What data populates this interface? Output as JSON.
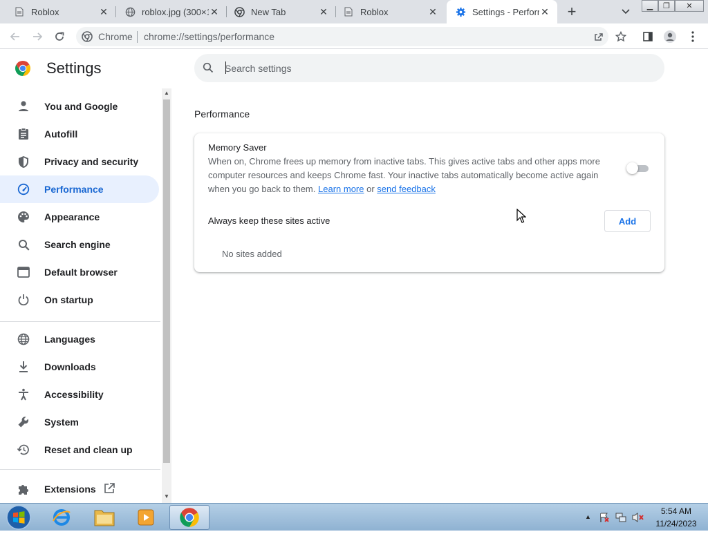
{
  "tabs": [
    {
      "title": "Roblox",
      "icon": "page-icon"
    },
    {
      "title": "roblox.jpg (300×1",
      "icon": "globe-icon"
    },
    {
      "title": "New Tab",
      "icon": "chrome-icon"
    },
    {
      "title": "Roblox",
      "icon": "page-icon"
    },
    {
      "title": "Settings - Perform",
      "icon": "gear-icon"
    }
  ],
  "omnibox": {
    "site_label": "Chrome",
    "url": "chrome://settings/performance"
  },
  "settings": {
    "title": "Settings",
    "search_placeholder": "Search settings",
    "nav_items": [
      {
        "label": "You and Google",
        "icon": "person-icon"
      },
      {
        "label": "Autofill",
        "icon": "clipboard-icon"
      },
      {
        "label": "Privacy and security",
        "icon": "shield-icon"
      },
      {
        "label": "Performance",
        "icon": "speedometer-icon",
        "active": true
      },
      {
        "label": "Appearance",
        "icon": "palette-icon"
      },
      {
        "label": "Search engine",
        "icon": "search-icon"
      },
      {
        "label": "Default browser",
        "icon": "browser-icon"
      },
      {
        "label": "On startup",
        "icon": "power-icon"
      },
      {
        "label": "Languages",
        "icon": "globe-icon"
      },
      {
        "label": "Downloads",
        "icon": "download-icon"
      },
      {
        "label": "Accessibility",
        "icon": "accessibility-icon"
      },
      {
        "label": "System",
        "icon": "wrench-icon"
      },
      {
        "label": "Reset and clean up",
        "icon": "history-icon"
      },
      {
        "label": "Extensions",
        "icon": "puzzle-icon"
      }
    ]
  },
  "performance": {
    "heading": "Performance",
    "memory_saver": {
      "title": "Memory Saver",
      "description": "When on, Chrome frees up memory from inactive tabs. This gives active tabs and other apps more computer resources and keeps Chrome fast. Your inactive tabs automatically become active again when you go back to them.",
      "learn_more": "Learn more",
      "or": "or",
      "send_feedback": "send feedback",
      "enabled": false
    },
    "keep_active_label": "Always keep these sites active",
    "add_button": "Add",
    "no_sites": "No sites added"
  },
  "taskbar": {
    "time": "5:54 AM",
    "date": "11/24/2023"
  },
  "colors": {
    "accent": "#1a73e8",
    "active_nav_bg": "#e8f0fe",
    "tabstrip": "#dee1e6"
  }
}
